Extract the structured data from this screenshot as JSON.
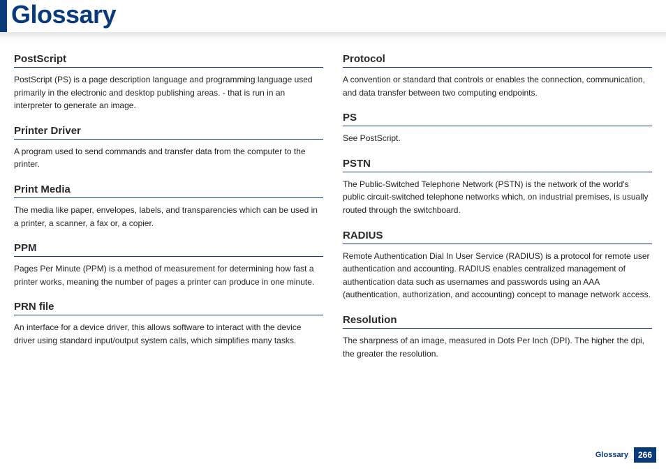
{
  "page_title": "Glossary",
  "footer": {
    "label": "Glossary",
    "page": "266"
  },
  "left": [
    {
      "term": "PostScript",
      "definition": "PostScript (PS) is a page description language and programming language used primarily in the electronic and desktop publishing areas. - that is run in an interpreter to generate an image."
    },
    {
      "term": "Printer Driver",
      "definition": "A program used to send commands and transfer data from the computer to the printer."
    },
    {
      "term": "Print Media",
      "definition": "The media like paper, envelopes, labels, and transparencies which can be used in a printer, a scanner, a fax or, a copier."
    },
    {
      "term": "PPM",
      "definition": "Pages Per Minute (PPM) is a method of measurement for determining how fast a printer works, meaning the number of pages a printer can produce in one minute."
    },
    {
      "term": "PRN file",
      "definition": "An interface for a device driver, this allows software to interact with the device driver using standard input/output system calls, which simplifies many tasks."
    }
  ],
  "right": [
    {
      "term": "Protocol",
      "definition": "A convention or standard that controls or enables the connection, communication, and data transfer between two computing endpoints."
    },
    {
      "term": "PS",
      "definition": "See PostScript."
    },
    {
      "term": "PSTN",
      "definition": "The Public-Switched Telephone Network (PSTN) is the network of the world's public circuit-switched telephone networks which, on industrial premises, is usually routed through the switchboard."
    },
    {
      "term": "RADIUS",
      "definition": "Remote Authentication Dial In User Service (RADIUS) is a protocol for remote user authentication and accounting. RADIUS enables centralized management of authentication data such as usernames and passwords using an AAA (authentication, authorization, and accounting) concept to manage network access."
    },
    {
      "term": "Resolution",
      "definition": "The sharpness of an image, measured in Dots Per Inch (DPI). The higher the dpi, the greater the resolution."
    }
  ]
}
